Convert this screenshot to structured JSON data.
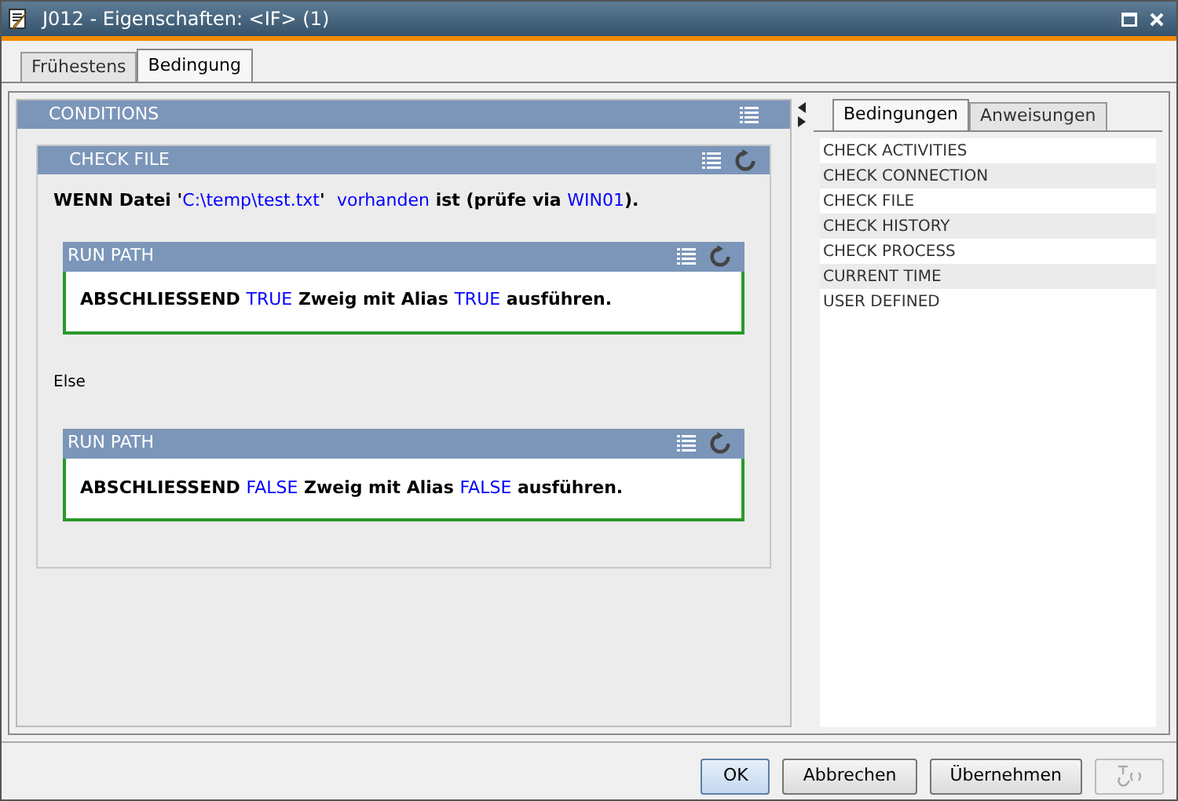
{
  "window": {
    "title": "J012 - Eigenschaften: <IF> (1)"
  },
  "tabs": [
    {
      "label": "Frühestens",
      "selected": false
    },
    {
      "label": "Bedingung",
      "selected": true
    }
  ],
  "conditions": {
    "title": "CONDITIONS",
    "check": {
      "title": "CHECK FILE",
      "sentence": [
        {
          "text": "WENN Datei '",
          "highlight": false
        },
        {
          "text": "C:\\temp\\test.txt",
          "highlight": true
        },
        {
          "text": "'  ",
          "highlight": false
        },
        {
          "text": "vorhanden",
          "highlight": true
        },
        {
          "text": " ist (prüfe via ",
          "highlight": false
        },
        {
          "text": "WIN01",
          "highlight": true
        },
        {
          "text": ").",
          "highlight": false
        }
      ]
    },
    "branches": [
      {
        "kind": "run",
        "title": "RUN PATH",
        "sentence": [
          {
            "text": "ABSCHLIESSEND ",
            "highlight": false
          },
          {
            "text": "TRUE",
            "highlight": true
          },
          {
            "text": " Zweig mit Alias ",
            "highlight": false
          },
          {
            "text": "TRUE",
            "highlight": true
          },
          {
            "text": " ausführen.",
            "highlight": false
          }
        ]
      },
      {
        "kind": "label",
        "text": "Else"
      },
      {
        "kind": "run",
        "title": "RUN PATH",
        "sentence": [
          {
            "text": "ABSCHLIESSEND ",
            "highlight": false
          },
          {
            "text": "FALSE",
            "highlight": true
          },
          {
            "text": " Zweig mit Alias ",
            "highlight": false
          },
          {
            "text": "FALSE",
            "highlight": true
          },
          {
            "text": " ausführen.",
            "highlight": false
          }
        ]
      }
    ]
  },
  "side_tabs": [
    {
      "label": "Bedingungen",
      "selected": true
    },
    {
      "label": "Anweisungen",
      "selected": false
    }
  ],
  "side_items": [
    "CHECK ACTIVITIES",
    "CHECK CONNECTION",
    "CHECK FILE",
    "CHECK HISTORY",
    "CHECK PROCESS",
    "CURRENT TIME",
    "USER DEFINED"
  ],
  "buttons": [
    {
      "label": "OK",
      "default": true
    },
    {
      "label": "Abbrechen",
      "default": false
    },
    {
      "label": "Übernehmen",
      "default": false
    }
  ]
}
